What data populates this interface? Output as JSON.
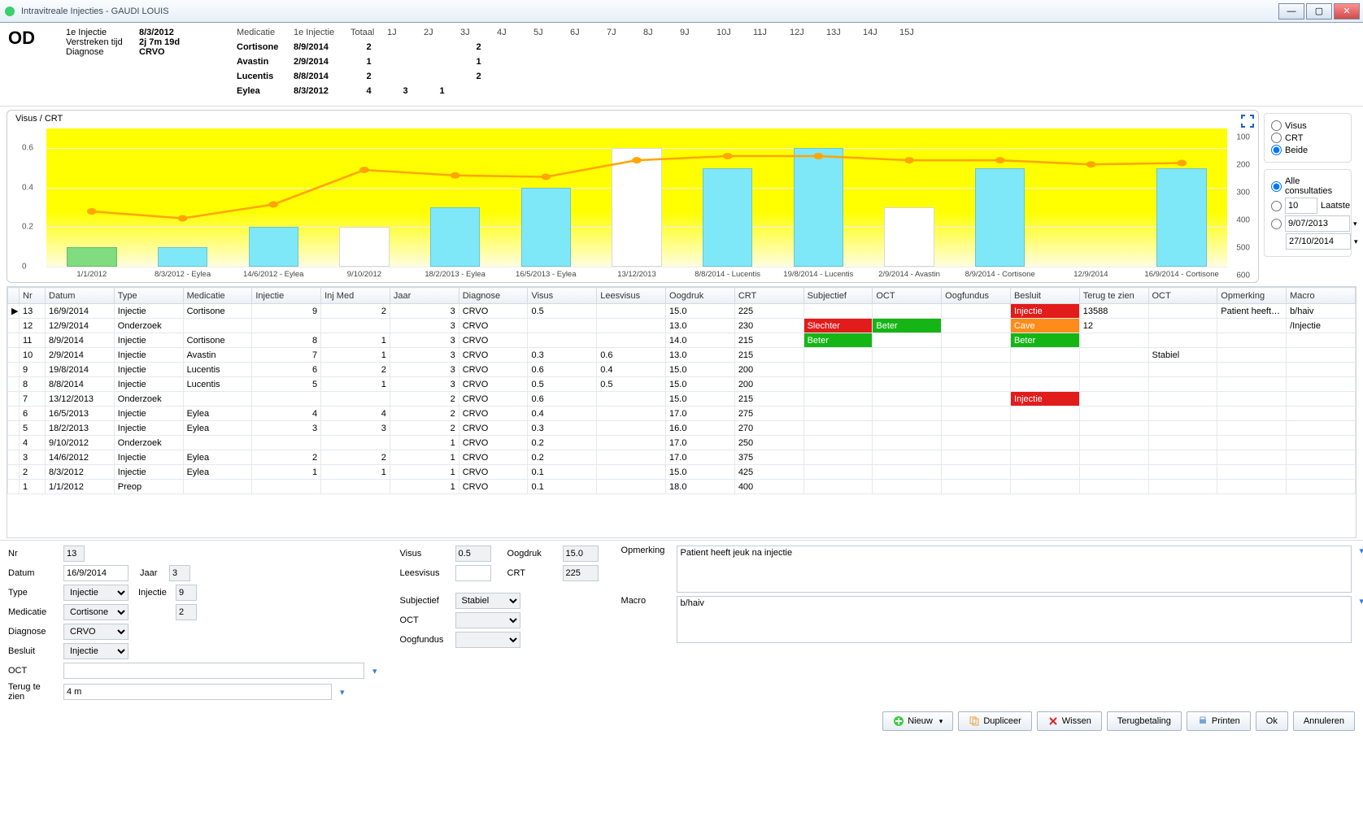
{
  "window": {
    "title": "Intravitreale Injecties - GAUDI LOUIS"
  },
  "header": {
    "eye": "OD",
    "labels": {
      "first_injection": "1e Injectie",
      "elapsed": "Verstreken tijd",
      "diagnose": "Diagnose",
      "medication": "Medicatie",
      "total": "Totaal"
    },
    "first_injection": "8/3/2012",
    "elapsed": "2j 7m 19d",
    "diagnose": "CRVO"
  },
  "med_table": {
    "cols": [
      "Medicatie",
      "1e Injectie",
      "Totaal",
      "1J",
      "2J",
      "3J",
      "4J",
      "5J",
      "6J",
      "7J",
      "8J",
      "9J",
      "10J",
      "11J",
      "12J",
      "13J",
      "14J",
      "15J"
    ],
    "rows": [
      {
        "name": "Cortisone",
        "first": "8/9/2014",
        "total": "2",
        "y": [
          "",
          "",
          "2",
          "",
          "",
          "",
          "",
          "",
          "",
          "",
          "",
          "",
          "",
          "",
          "",
          ""
        ]
      },
      {
        "name": "Avastin",
        "first": "2/9/2014",
        "total": "1",
        "y": [
          "",
          "",
          "1",
          "",
          "",
          "",
          "",
          "",
          "",
          "",
          "",
          "",
          "",
          "",
          "",
          ""
        ]
      },
      {
        "name": "Lucentis",
        "first": "8/8/2014",
        "total": "2",
        "y": [
          "",
          "",
          "2",
          "",
          "",
          "",
          "",
          "",
          "",
          "",
          "",
          "",
          "",
          "",
          "",
          ""
        ]
      },
      {
        "name": "Eylea",
        "first": "8/3/2012",
        "total": "4",
        "y": [
          "3",
          "1",
          "",
          "",
          "",
          "",
          "",
          "",
          "",
          "",
          "",
          "",
          "",
          "",
          "",
          ""
        ]
      }
    ]
  },
  "chart_data": {
    "type": "bar+line",
    "title": "Visus / CRT",
    "y_left": {
      "label": "Visus",
      "ticks": [
        0,
        0.2,
        0.4,
        0.6
      ],
      "ylim": [
        0,
        0.7
      ]
    },
    "y_right": {
      "label": "CRT",
      "ticks": [
        100,
        200,
        300,
        400,
        500,
        600
      ],
      "inverted": true
    },
    "categories": [
      "1/1/2012",
      "8/3/2012 - Eylea",
      "14/6/2012 - Eylea",
      "9/10/2012",
      "18/2/2013 - Eylea",
      "16/5/2013 - Eylea",
      "13/12/2013",
      "8/8/2014 - Lucentis",
      "19/8/2014 - Lucentis",
      "2/9/2014 - Avastin",
      "8/9/2014 - Cortisone",
      "12/9/2014",
      "16/9/2014 - Cortisone"
    ],
    "series": [
      {
        "name": "Visus",
        "type": "bar",
        "values": [
          0.1,
          0.1,
          0.2,
          0.2,
          0.3,
          0.4,
          0.6,
          0.5,
          0.6,
          0.3,
          0.5,
          null,
          0.5
        ],
        "colors": [
          "#7fdc7f",
          "#7fe8f8",
          "#7fe8f8",
          "#ffffff",
          "#7fe8f8",
          "#7fe8f8",
          "#ffffff",
          "#7fe8f8",
          "#7fe8f8",
          "#ffffff",
          "#7fe8f8",
          null,
          "#7fe8f8"
        ]
      },
      {
        "name": "CRT",
        "type": "line",
        "values": [
          400,
          425,
          375,
          250,
          270,
          275,
          215,
          200,
          200,
          215,
          215,
          230,
          225
        ],
        "color": "#ffa500"
      }
    ]
  },
  "chart_controls": {
    "mode": {
      "options": [
        "Visus",
        "CRT",
        "Beide"
      ],
      "selected": "Beide"
    },
    "range": {
      "options": [
        "Alle consultaties",
        "Laatste",
        "DateRange"
      ],
      "selected": "Alle consultaties",
      "laatste_n": "10",
      "from": "9/07/2013",
      "to": "27/10/2014"
    },
    "laatste_label": "Laatste"
  },
  "table": {
    "headers": [
      "",
      "Nr",
      "Datum",
      "Type",
      "Medicatie",
      "Injectie",
      "Inj Med",
      "Jaar",
      "Diagnose",
      "Visus",
      "Leesvisus",
      "Oogdruk",
      "CRT",
      "Subjectief",
      "OCT",
      "Oogfundus",
      "Besluit",
      "Terug te zien",
      "OCT",
      "Opmerking",
      "Macro"
    ],
    "rows": [
      {
        "marker": "▶",
        "nr": "13",
        "datum": "16/9/2014",
        "type": "Injectie",
        "med": "Cortisone",
        "inj": "9",
        "injmed": "2",
        "jaar": "3",
        "diag": "CRVO",
        "visus": "0.5",
        "lees": "",
        "oog": "15.0",
        "crt": "225",
        "subj": "",
        "oct": "",
        "fund": "",
        "besluit": "Injectie",
        "besluit_cls": "cell-red",
        "terug": "13588",
        "oct2": "",
        "opm": "Patient heeft…",
        "macro": "b/haiv"
      },
      {
        "marker": "",
        "nr": "12",
        "datum": "12/9/2014",
        "type": "Onderzoek",
        "med": "",
        "inj": "",
        "injmed": "",
        "jaar": "3",
        "diag": "CRVO",
        "visus": "",
        "lees": "",
        "oog": "13.0",
        "crt": "230",
        "subj": "Slechter",
        "subj_cls": "cell-red",
        "oct": "Beter",
        "oct_cls": "cell-green",
        "fund": "",
        "besluit": "Cave",
        "besluit_cls": "cell-orange",
        "terug": "12",
        "oct2": "",
        "opm": "",
        "macro": "/Injectie"
      },
      {
        "marker": "",
        "nr": "11",
        "datum": "8/9/2014",
        "type": "Injectie",
        "med": "Cortisone",
        "inj": "8",
        "injmed": "1",
        "jaar": "3",
        "diag": "CRVO",
        "visus": "",
        "lees": "",
        "oog": "14.0",
        "crt": "215",
        "subj": "Beter",
        "subj_cls": "cell-green",
        "oct": "",
        "fund": "",
        "besluit": "Beter",
        "besluit_cls": "cell-green",
        "terug": "",
        "oct2": "",
        "opm": "",
        "macro": ""
      },
      {
        "marker": "",
        "nr": "10",
        "datum": "2/9/2014",
        "type": "Injectie",
        "med": "Avastin",
        "inj": "7",
        "injmed": "1",
        "jaar": "3",
        "diag": "CRVO",
        "visus": "0.3",
        "lees": "0.6",
        "oog": "13.0",
        "crt": "215",
        "subj": "",
        "oct": "",
        "fund": "",
        "besluit": "",
        "terug": "",
        "oct2": "Stabiel",
        "opm": "",
        "macro": ""
      },
      {
        "marker": "",
        "nr": "9",
        "datum": "19/8/2014",
        "type": "Injectie",
        "med": "Lucentis",
        "inj": "6",
        "injmed": "2",
        "jaar": "3",
        "diag": "CRVO",
        "visus": "0.6",
        "lees": "0.4",
        "oog": "15.0",
        "crt": "200",
        "subj": "",
        "oct": "",
        "fund": "",
        "besluit": "",
        "terug": "",
        "oct2": "",
        "opm": "",
        "macro": ""
      },
      {
        "marker": "",
        "nr": "8",
        "datum": "8/8/2014",
        "type": "Injectie",
        "med": "Lucentis",
        "inj": "5",
        "injmed": "1",
        "jaar": "3",
        "diag": "CRVO",
        "visus": "0.5",
        "lees": "0.5",
        "oog": "15.0",
        "crt": "200",
        "subj": "",
        "oct": "",
        "fund": "",
        "besluit": "",
        "terug": "",
        "oct2": "",
        "opm": "",
        "macro": ""
      },
      {
        "marker": "",
        "nr": "7",
        "datum": "13/12/2013",
        "type": "Onderzoek",
        "med": "",
        "inj": "",
        "injmed": "",
        "jaar": "2",
        "diag": "CRVO",
        "visus": "0.6",
        "lees": "",
        "oog": "15.0",
        "crt": "215",
        "subj": "",
        "oct": "",
        "fund": "",
        "besluit": "Injectie",
        "besluit_cls": "cell-red",
        "terug": "",
        "oct2": "",
        "opm": "",
        "macro": ""
      },
      {
        "marker": "",
        "nr": "6",
        "datum": "16/5/2013",
        "type": "Injectie",
        "med": "Eylea",
        "inj": "4",
        "injmed": "4",
        "jaar": "2",
        "diag": "CRVO",
        "visus": "0.4",
        "lees": "",
        "oog": "17.0",
        "crt": "275",
        "subj": "",
        "oct": "",
        "fund": "",
        "besluit": "",
        "terug": "",
        "oct2": "",
        "opm": "",
        "macro": ""
      },
      {
        "marker": "",
        "nr": "5",
        "datum": "18/2/2013",
        "type": "Injectie",
        "med": "Eylea",
        "inj": "3",
        "injmed": "3",
        "jaar": "2",
        "diag": "CRVO",
        "visus": "0.3",
        "lees": "",
        "oog": "16.0",
        "crt": "270",
        "subj": "",
        "oct": "",
        "fund": "",
        "besluit": "",
        "terug": "",
        "oct2": "",
        "opm": "",
        "macro": ""
      },
      {
        "marker": "",
        "nr": "4",
        "datum": "9/10/2012",
        "type": "Onderzoek",
        "med": "",
        "inj": "",
        "injmed": "",
        "jaar": "1",
        "diag": "CRVO",
        "visus": "0.2",
        "lees": "",
        "oog": "17.0",
        "crt": "250",
        "subj": "",
        "oct": "",
        "fund": "",
        "besluit": "",
        "terug": "",
        "oct2": "",
        "opm": "",
        "macro": ""
      },
      {
        "marker": "",
        "nr": "3",
        "datum": "14/6/2012",
        "type": "Injectie",
        "med": "Eylea",
        "inj": "2",
        "injmed": "2",
        "jaar": "1",
        "diag": "CRVO",
        "visus": "0.2",
        "lees": "",
        "oog": "17.0",
        "crt": "375",
        "subj": "",
        "oct": "",
        "fund": "",
        "besluit": "",
        "terug": "",
        "oct2": "",
        "opm": "",
        "macro": ""
      },
      {
        "marker": "",
        "nr": "2",
        "datum": "8/3/2012",
        "type": "Injectie",
        "med": "Eylea",
        "inj": "1",
        "injmed": "1",
        "jaar": "1",
        "diag": "CRVO",
        "visus": "0.1",
        "lees": "",
        "oog": "15.0",
        "crt": "425",
        "subj": "",
        "oct": "",
        "fund": "",
        "besluit": "",
        "terug": "",
        "oct2": "",
        "opm": "",
        "macro": ""
      },
      {
        "marker": "",
        "nr": "1",
        "datum": "1/1/2012",
        "type": "Preop",
        "med": "",
        "inj": "",
        "injmed": "",
        "jaar": "1",
        "diag": "CRVO",
        "visus": "0.1",
        "lees": "",
        "oog": "18.0",
        "crt": "400",
        "subj": "",
        "oct": "",
        "fund": "",
        "besluit": "",
        "terug": "",
        "oct2": "",
        "opm": "",
        "macro": ""
      }
    ]
  },
  "form": {
    "labels": {
      "nr": "Nr",
      "datum": "Datum",
      "jaar": "Jaar",
      "type": "Type",
      "injectie": "Injectie",
      "medicatie": "Medicatie",
      "diagnose": "Diagnose",
      "besluit": "Besluit",
      "oct": "OCT",
      "terug": "Terug te zien",
      "visus": "Visus",
      "leesvisus": "Leesvisus",
      "subjectief": "Subjectief",
      "oogfundus": "Oogfundus",
      "oogdruk": "Oogdruk",
      "crt": "CRT",
      "opmerking": "Opmerking",
      "macro": "Macro"
    },
    "values": {
      "nr": "13",
      "datum": "16/9/2014",
      "jaar": "3",
      "type": "Injectie",
      "injectie": "9",
      "medicatie": "Cortisone",
      "injmed": "2",
      "diagnose": "CRVO",
      "besluit": "Injectie",
      "oct": "",
      "terug": "4 m",
      "visus": "0.5",
      "leesvisus": "",
      "subjectief": "Stabiel",
      "oogfundus": "",
      "oogdruk": "15.0",
      "crt": "225",
      "opmerking": "Patient heeft jeuk na injectie",
      "macro": "b/haiv"
    }
  },
  "buttons": {
    "nieuw": "Nieuw",
    "dupliceer": "Dupliceer",
    "wissen": "Wissen",
    "terugbetaling": "Terugbetaling",
    "printen": "Printen",
    "ok": "Ok",
    "annuleren": "Annuleren"
  }
}
